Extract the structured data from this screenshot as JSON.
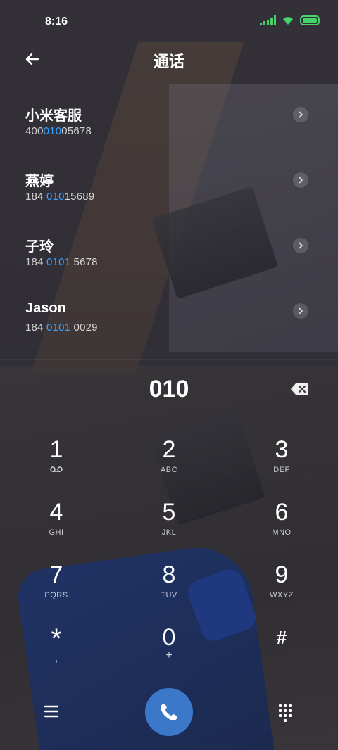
{
  "status_bar": {
    "time": "8:16"
  },
  "header": {
    "title": "通话"
  },
  "results": [
    {
      "name": "小米客服",
      "num_pre": "400",
      "num_hl": "010",
      "num_post": "05678"
    },
    {
      "name": "燕婷",
      "num_pre": "184 ",
      "num_hl": "010",
      "num_post": "15689"
    },
    {
      "name": "子玲",
      "num_pre": "184 ",
      "num_hl": "0101",
      "num_post": " 5678"
    },
    {
      "name": "Jason",
      "num_pre": "184 ",
      "num_hl": "0101",
      "num_post": " 0029"
    }
  ],
  "dialer": {
    "typed": "010",
    "keys": [
      {
        "digit": "1",
        "letters": ""
      },
      {
        "digit": "2",
        "letters": "ABC"
      },
      {
        "digit": "3",
        "letters": "DEF"
      },
      {
        "digit": "4",
        "letters": "GHI"
      },
      {
        "digit": "5",
        "letters": "JKL"
      },
      {
        "digit": "6",
        "letters": "MNO"
      },
      {
        "digit": "7",
        "letters": "PQRS"
      },
      {
        "digit": "8",
        "letters": "TUV"
      },
      {
        "digit": "9",
        "letters": "WXYZ"
      },
      {
        "digit": "*",
        "letters": ","
      },
      {
        "digit": "0",
        "letters": "+"
      },
      {
        "digit": "#",
        "letters": ""
      }
    ]
  },
  "colors": {
    "highlight": "#3aa2ff",
    "call_button": "#3b78c9",
    "signal_green": "#46d36b"
  }
}
